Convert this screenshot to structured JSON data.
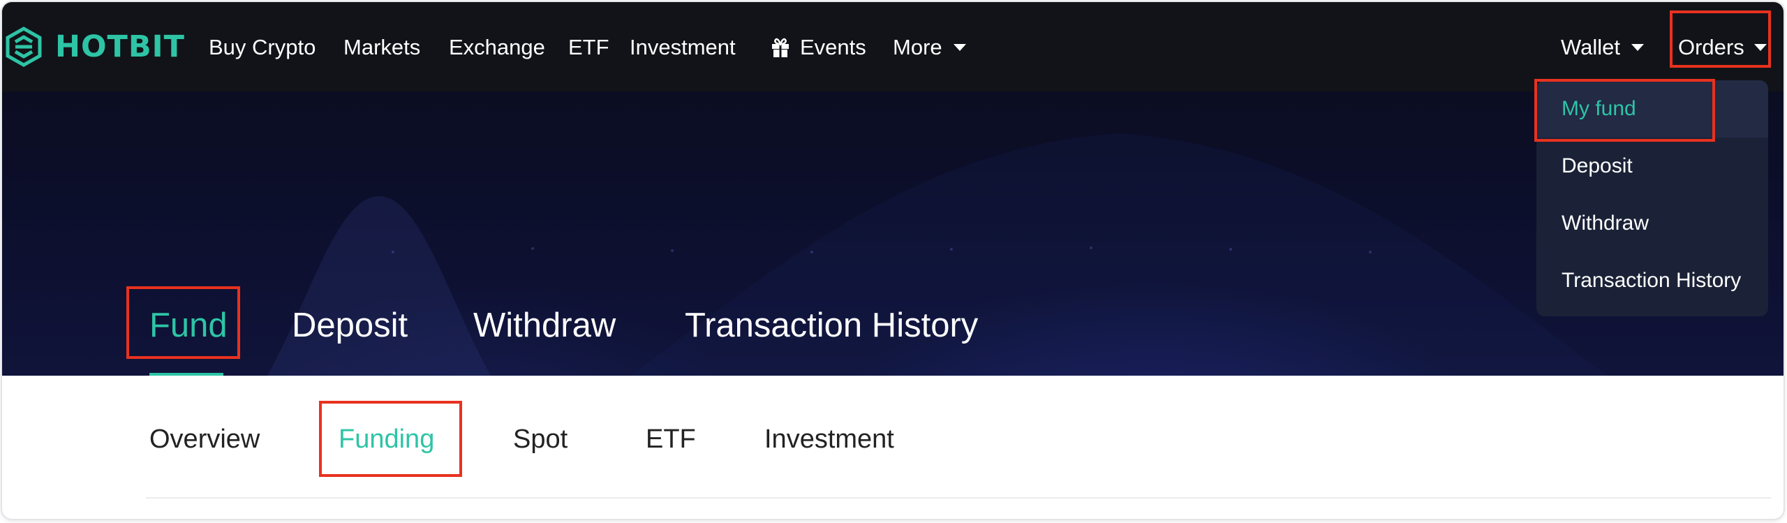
{
  "brand": {
    "name": "HOTBIT",
    "accent_color": "#2ec4a6"
  },
  "topnav": {
    "items": [
      {
        "label": "Buy Crypto"
      },
      {
        "label": "Markets"
      },
      {
        "label": "Exchange"
      },
      {
        "label": "ETF"
      },
      {
        "label": "Investment"
      },
      {
        "label": "Events",
        "icon": "gift-icon"
      },
      {
        "label": "More",
        "icon": "caret-down-icon"
      }
    ],
    "wallet_label": "Wallet",
    "orders_label": "Orders"
  },
  "orders_dropdown": {
    "items": [
      {
        "label": "My fund",
        "active": true
      },
      {
        "label": "Deposit"
      },
      {
        "label": "Withdraw"
      },
      {
        "label": "Transaction History"
      }
    ]
  },
  "hero_tabs": {
    "items": [
      {
        "label": "Fund",
        "active": true
      },
      {
        "label": "Deposit"
      },
      {
        "label": "Withdraw"
      },
      {
        "label": "Transaction History"
      }
    ]
  },
  "sub_tabs": {
    "items": [
      {
        "label": "Overview"
      },
      {
        "label": "Funding",
        "active": true
      },
      {
        "label": "Spot"
      },
      {
        "label": "ETF"
      },
      {
        "label": "Investment"
      }
    ]
  },
  "annotation_color": "#e8321f"
}
